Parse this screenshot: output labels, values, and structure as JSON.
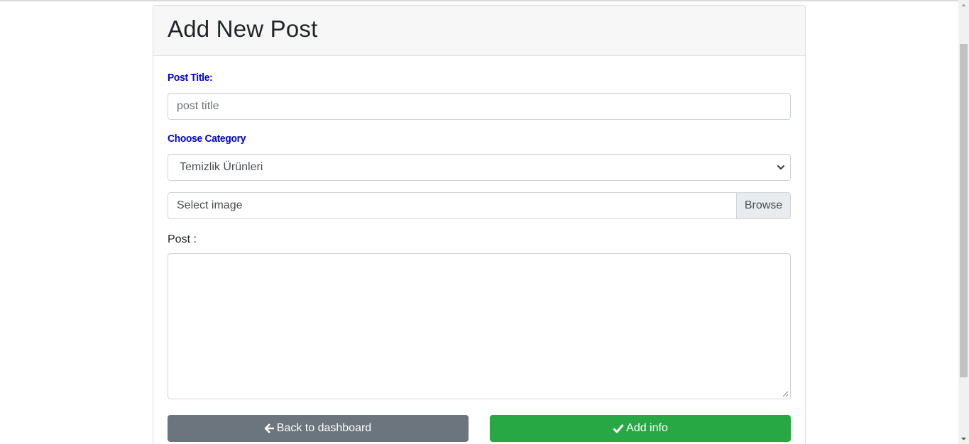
{
  "header": {
    "title": "Add New Post"
  },
  "form": {
    "post_title_label": "Post Title:",
    "post_title_placeholder": "post title",
    "post_title_value": "",
    "category_label": "Choose Category",
    "category_selected": "Temizlik Ürünleri",
    "image_label": "Select image",
    "browse_label": "Browse",
    "post_label": "Post :",
    "post_value": ""
  },
  "actions": {
    "back_label": "Back to dashboard",
    "back_icon": "arrow-left-icon",
    "add_label": "Add info",
    "add_icon": "check-icon"
  },
  "colors": {
    "label_accent": "#0000e6",
    "secondary": "#6c757d",
    "success": "#28a745"
  }
}
